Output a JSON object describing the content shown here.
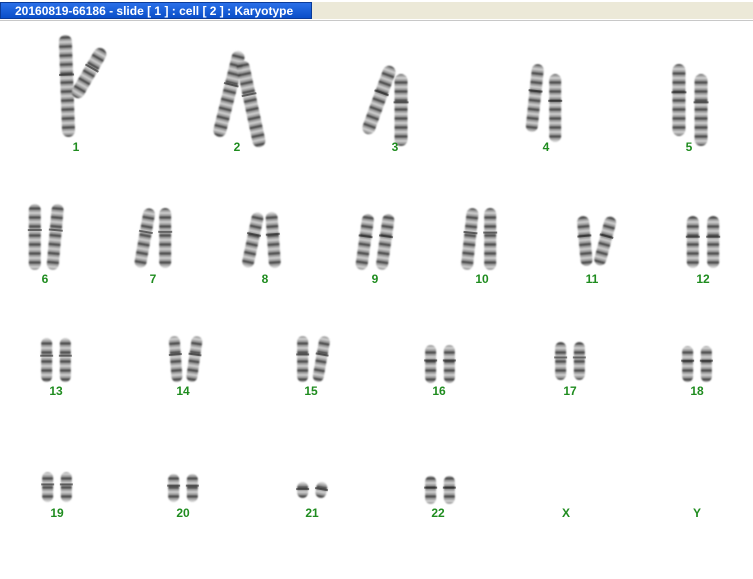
{
  "window": {
    "title": "20160819-66186 - slide [ 1 ] : cell [ 2 ] : Karyotype"
  },
  "label_color": "#1f8c1f",
  "chromosomes": [
    {
      "label": "1"
    },
    {
      "label": "2"
    },
    {
      "label": "3"
    },
    {
      "label": "4"
    },
    {
      "label": "5"
    },
    {
      "label": "6"
    },
    {
      "label": "7"
    },
    {
      "label": "8"
    },
    {
      "label": "9"
    },
    {
      "label": "10"
    },
    {
      "label": "11"
    },
    {
      "label": "12"
    },
    {
      "label": "13"
    },
    {
      "label": "14"
    },
    {
      "label": "15"
    },
    {
      "label": "16"
    },
    {
      "label": "17"
    },
    {
      "label": "18"
    },
    {
      "label": "19"
    },
    {
      "label": "20"
    },
    {
      "label": "21"
    },
    {
      "label": "22"
    },
    {
      "label": "X"
    },
    {
      "label": "Y"
    }
  ]
}
